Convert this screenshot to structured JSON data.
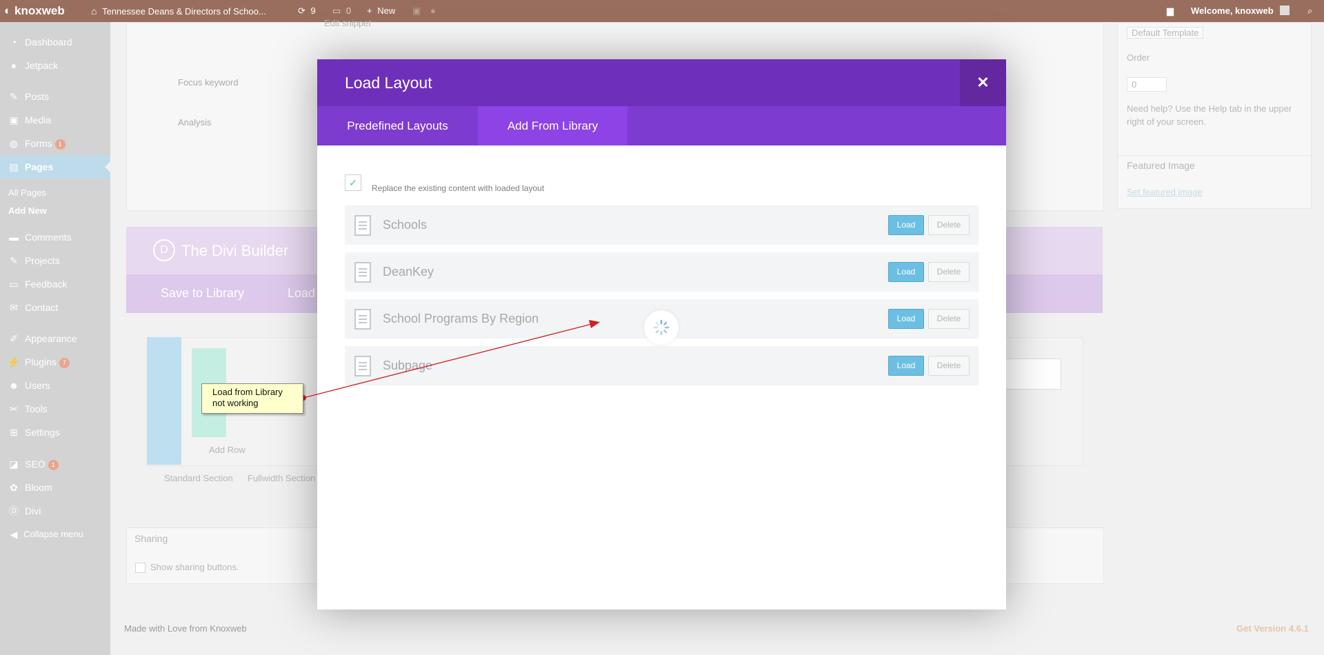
{
  "admin_bar": {
    "brand": "knoxweb",
    "site_name": "Tennessee Deans & Directors of Schoo...",
    "updates_count": "9",
    "comments_count": "0",
    "new_label": "New",
    "welcome_label": "Welcome, knoxweb"
  },
  "sidebar": {
    "items": [
      {
        "label": "Dashboard",
        "icon": "dashboard-icon"
      },
      {
        "label": "Jetpack",
        "icon": "jetpack-icon"
      },
      {
        "label": "Posts",
        "icon": "pin-icon"
      },
      {
        "label": "Media",
        "icon": "media-icon"
      },
      {
        "label": "Forms",
        "icon": "forms-icon",
        "badge": "1"
      },
      {
        "label": "Pages",
        "icon": "pages-icon"
      },
      {
        "label": "Comments",
        "icon": "comments-icon"
      },
      {
        "label": "Projects",
        "icon": "projects-icon"
      },
      {
        "label": "Feedback",
        "icon": "feedback-icon"
      },
      {
        "label": "Contact",
        "icon": "contact-icon"
      },
      {
        "label": "Appearance",
        "icon": "appearance-icon"
      },
      {
        "label": "Plugins",
        "icon": "plugins-icon",
        "badge": "7"
      },
      {
        "label": "Users",
        "icon": "users-icon"
      },
      {
        "label": "Tools",
        "icon": "tools-icon"
      },
      {
        "label": "Settings",
        "icon": "settings-icon"
      },
      {
        "label": "SEO",
        "icon": "seo-icon",
        "badge": "1"
      },
      {
        "label": "Bloom",
        "icon": "bloom-icon"
      },
      {
        "label": "Divi",
        "icon": "divi-icon"
      }
    ],
    "submenu": [
      "All Pages",
      "Add New"
    ],
    "collapse_label": "Collapse menu"
  },
  "background": {
    "edit_snippet": "Edit snippet",
    "focus_keyword": "Focus keyword",
    "analysis": "Analysis",
    "default_template": "Default Template",
    "order_label": "Order",
    "order_value": "0",
    "help_text_1": "Need help? Use the Help tab in the upper",
    "help_text_2": "right of your screen.",
    "featured_image": "Featured Image",
    "set_featured_image": "Set featured image",
    "divi_builder": "The Divi Builder",
    "save_to_library": "Save to Library",
    "load_partial": "Load",
    "add_row": "Add Row",
    "standard_section": "Standard Section",
    "fullwidth_section": "Fullwidth Section",
    "sharing": "Sharing",
    "show_sharing": "Show sharing buttons.",
    "footer_left": "Made with Love from Knoxweb",
    "footer_right": "Get Version 4.6.1"
  },
  "modal": {
    "title": "Load Layout",
    "tabs": [
      {
        "label": "Predefined Layouts",
        "active": false
      },
      {
        "label": "Add From Library",
        "active": true
      }
    ],
    "replace_label": "Replace the existing content with loaded layout",
    "replace_checked": true,
    "layouts": [
      {
        "name": "Schools"
      },
      {
        "name": "DeanKey"
      },
      {
        "name": "School Programs By Region"
      },
      {
        "name": "Subpage"
      }
    ],
    "load_label": "Load",
    "delete_label": "Delete"
  },
  "annotation": {
    "line1": "Load from Library",
    "line2": "not working"
  },
  "colors": {
    "modal_header": "#6e2fba",
    "modal_tabs": "#7e3bd0",
    "active_tab": "#8d43e6",
    "load_button": "#6cbfe3",
    "admin_bar": "#9a6e5e"
  }
}
